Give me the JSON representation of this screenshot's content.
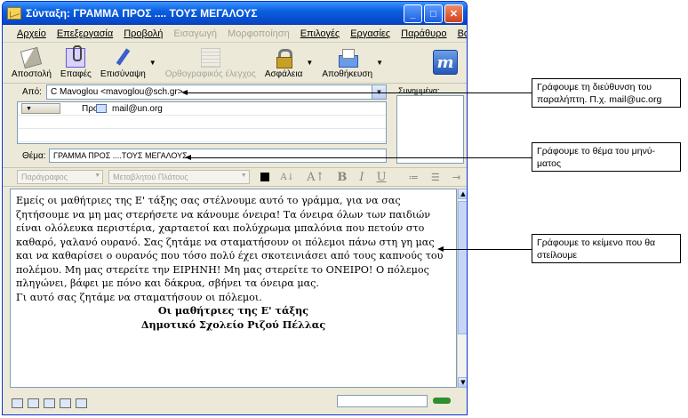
{
  "window": {
    "title": "Σύνταξη: ΓΡΑΜΜΑ ΠΡΟΣ .... ΤΟΥΣ ΜΕΓΑΛΟΥΣ",
    "min_label": "_",
    "max_label": "□",
    "close_label": "✕"
  },
  "menu": {
    "items": [
      {
        "label": "Αρχείο",
        "enabled": true
      },
      {
        "label": "Επεξεργασία",
        "enabled": true
      },
      {
        "label": "Προβολή",
        "enabled": true
      },
      {
        "label": "Εισαγωγή",
        "enabled": false
      },
      {
        "label": "Μορφοποίηση",
        "enabled": false
      },
      {
        "label": "Επιλογές",
        "enabled": true
      },
      {
        "label": "Εργασίες",
        "enabled": true
      },
      {
        "label": "Παράθυρο",
        "enabled": true
      },
      {
        "label": "Βοήθεια",
        "enabled": true
      }
    ]
  },
  "toolbar": {
    "send": "Αποστολή",
    "attach": "Επαφές",
    "attach_file": "Επισύναψη",
    "spellcheck": "Ορθογραφικός έλεγχος",
    "security": "Ασφάλεια",
    "save": "Αποθήκευση"
  },
  "header": {
    "from_label": "Από:",
    "from_value": "C Mavoglou <mavoglou@sch.gr>",
    "to_label": "Προς:",
    "to_value": "mail@un.org",
    "subject_label": "Θέμα:",
    "subject_value": "ΓΡΑΜΜΑ ΠΡΟΣ ....ΤΟΥΣ ΜΕΓΑΛΟΥΣ",
    "attachments_label": "Συνημμένα:"
  },
  "format": {
    "paragraph": "Παράγραφος",
    "font": "Μεταβλητού Πλάτους",
    "bold": "B",
    "italic": "I",
    "underline": "U"
  },
  "message": {
    "body": "Εμείς οι μαθήτριες της Ε' τάξης σας στέλνουμε αυτό το γράμμα, για να σας ζητήσουμε να μη μας στερήσετε να κάνουμε όνειρα! Τα όνειρα όλων των παιδιών είναι ολόλευκα περιστέρια, χαρταετοί και πολύχρωμα μπαλόνια που πετούν στο καθαρό, γαλανό ουρανό. Σας ζητάμε να σταματήσουν οι πόλεμοι πάνω στη γη μας και να καθαρίσει ο ουρανός που τόσο πολύ έχει σκοτεινιάσει από τους καπνούς του πολέμου. Μη μας στερείτε την ΕΙΡΗΝΗ! Μη μας στερείτε το ΟΝΕΙΡΟ! Ο πόλεμος πληγώνει, βάφει με πόνο και δάκρυα, σβήνει τα όνειρα μας.",
    "line2": "Γι αυτό σας ζητάμε να σταματήσουν οι πόλεμοι.",
    "signature1": "Οι μαθήτριες της Ε' τάξης",
    "signature2": "Δημοτικό Σχολείο Ριζού Πέλλας"
  },
  "callouts": {
    "address": "Γράφουμε τη διεύθυνση του παραλήπτη. Π.χ. mail@uc.org",
    "subject": "Γράφουμε το θέμα του μηνύ-ματος",
    "body": "Γράφουμε το κείμενο που θα στείλουμε"
  }
}
